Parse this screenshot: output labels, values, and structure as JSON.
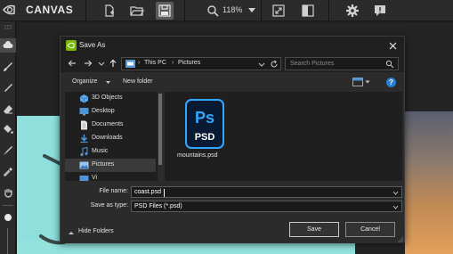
{
  "app": {
    "brand": "CANVAS",
    "zoom": "118%",
    "accent": "#76b900"
  },
  "toolbar": {
    "icons": [
      "new-file-icon",
      "open-folder-icon",
      "save-icon",
      "search-icon",
      "fit-to-screen-icon",
      "split-view-icon",
      "gear-icon",
      "feedback-icon"
    ],
    "active": "save-icon"
  },
  "left_tools": [
    "cloud-icon",
    "brush-icon",
    "paint-brush-icon",
    "eraser-icon",
    "fill-bucket-icon",
    "brush-alt-icon",
    "eyedropper-icon",
    "hand-icon",
    "brush-size-dot-icon"
  ],
  "dialog": {
    "title": "Save As",
    "breadcrumb": [
      "This PC",
      "Pictures"
    ],
    "search_placeholder": "Search Pictures",
    "organize_label": "Organize",
    "new_folder_label": "New folder",
    "tree": [
      {
        "label": "3D Objects",
        "icon": "3d-objects-icon"
      },
      {
        "label": "Desktop",
        "icon": "desktop-icon"
      },
      {
        "label": "Documents",
        "icon": "documents-icon"
      },
      {
        "label": "Downloads",
        "icon": "downloads-icon"
      },
      {
        "label": "Music",
        "icon": "music-icon"
      },
      {
        "label": "Pictures",
        "icon": "pictures-icon",
        "selected": true
      },
      {
        "label": "Vi",
        "icon": "videos-icon"
      }
    ],
    "files": [
      {
        "name": "mountains.psd",
        "icon_text": "Ps",
        "icon_sub": "PSD"
      }
    ],
    "file_name_label": "File name:",
    "file_name_value": "coast.psd",
    "save_type_label": "Save as type:",
    "save_type_value": "PSD Files (*.psd)",
    "hide_folders_label": "Hide Folders",
    "save_label": "Save",
    "cancel_label": "Cancel"
  }
}
